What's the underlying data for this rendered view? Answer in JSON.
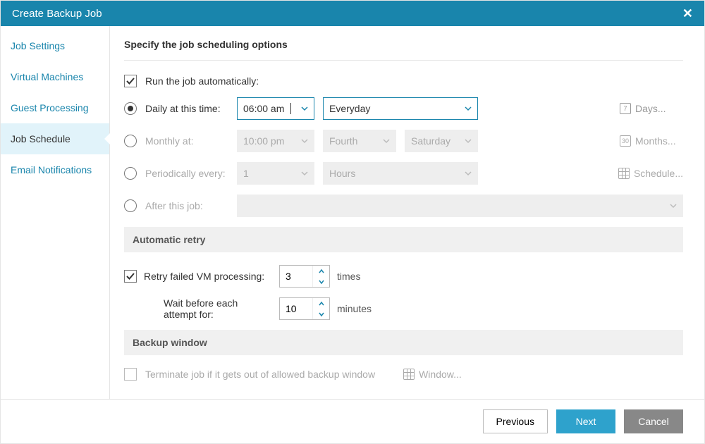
{
  "title": "Create Backup Job",
  "sidebar": {
    "items": [
      {
        "label": "Job Settings"
      },
      {
        "label": "Virtual Machines"
      },
      {
        "label": "Guest Processing"
      },
      {
        "label": "Job Schedule"
      },
      {
        "label": "Email Notifications"
      }
    ],
    "active_index": 3
  },
  "main": {
    "heading": "Specify the job scheduling options",
    "run_auto_label": "Run the job automatically:",
    "options": {
      "daily": {
        "label": "Daily at this time:",
        "time": "06:00 am",
        "repeat": "Everyday",
        "button": "Days..."
      },
      "monthly": {
        "label": "Monthly at:",
        "time": "10:00 pm",
        "ordinal": "Fourth",
        "weekday": "Saturday",
        "button": "Months..."
      },
      "periodic": {
        "label": "Periodically every:",
        "count": "1",
        "unit": "Hours",
        "button": "Schedule..."
      },
      "after": {
        "label": "After this job:"
      }
    },
    "retry": {
      "header": "Automatic retry",
      "retry_label": "Retry failed VM processing:",
      "retry_times": "3",
      "retry_unit": "times",
      "wait_label": "Wait before each attempt for:",
      "wait_minutes": "10",
      "wait_unit": "minutes"
    },
    "window": {
      "header": "Backup window",
      "terminate_label": "Terminate job if it gets out of allowed backup window",
      "button": "Window..."
    }
  },
  "footer": {
    "previous": "Previous",
    "next": "Next",
    "cancel": "Cancel"
  }
}
